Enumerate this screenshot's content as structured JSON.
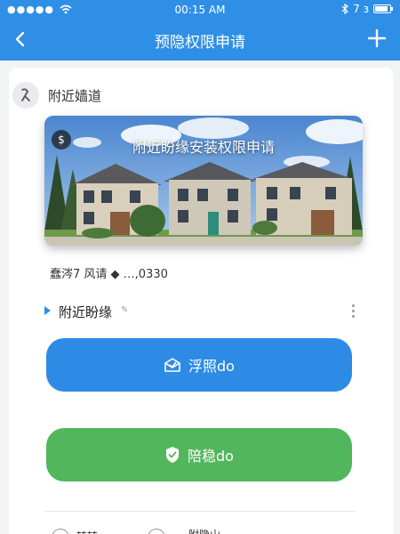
{
  "status_bar": {
    "signal_dots": "●●●●●",
    "time": "00:15 AM",
    "battery_text": "7 з",
    "battery_level": 0.85
  },
  "nav": {
    "title": "预隐权限申请"
  },
  "section": {
    "title": "附近嫱道"
  },
  "banner": {
    "title": "附近盼缘安装权限申请",
    "badge": "$"
  },
  "info_line": "蠢涔7 风请 ◆ …,0330",
  "list_row": {
    "label": "附近盼缘",
    "edit_glyph": "✎"
  },
  "buttons": {
    "primary_label": "浮照do",
    "secondary_label": "陪稳do"
  },
  "bottom_row": {
    "item1": "转转",
    "item2": "附隐山"
  },
  "colors": {
    "brand_blue": "#2f8fe6",
    "button_blue": "#2d8be6",
    "button_green": "#52b75c"
  }
}
